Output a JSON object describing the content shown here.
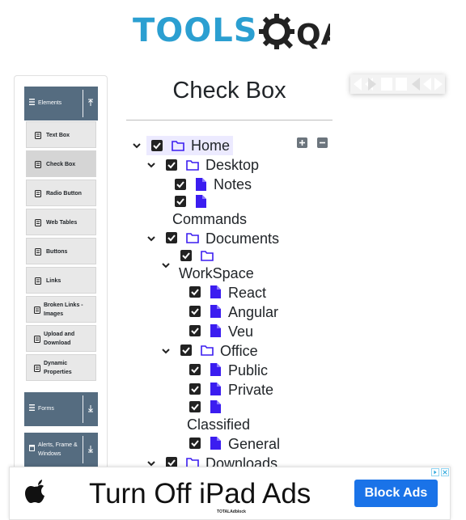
{
  "logo": {
    "word": "TOOLS",
    "suffix": "QA"
  },
  "sidebar": {
    "groups": [
      {
        "label": "Elements",
        "icon": "list-icon",
        "arrow": "collapse-arrow-icon"
      },
      {
        "label": "Forms",
        "icon": "list-icon",
        "arrow": "expand-arrow-icon"
      },
      {
        "label": "Alerts, Frame & Windows",
        "icon": "window-icon",
        "arrow": "expand-arrow-icon"
      }
    ],
    "items": [
      {
        "label": "Text Box"
      },
      {
        "label": "Check Box",
        "active": true
      },
      {
        "label": "Radio Button"
      },
      {
        "label": "Web Tables"
      },
      {
        "label": "Buttons"
      },
      {
        "label": "Links"
      },
      {
        "label": "Broken Links - Images"
      },
      {
        "label": "Upload and Download"
      },
      {
        "label": "Dynamic Properties"
      }
    ]
  },
  "main": {
    "title": "Check Box",
    "tree": {
      "home": "Home",
      "desktop": "Desktop",
      "notes": "Notes",
      "commands": "Commands",
      "documents": "Documents",
      "workspace": "WorkSpace",
      "react": "React",
      "angular": "Angular",
      "veu": "Veu",
      "office": "Office",
      "public": "Public",
      "private": "Private",
      "classified": "Classified",
      "general": "General",
      "downloads": "Downloads"
    },
    "expand_all_icon": "plus-square-icon",
    "collapse_all_icon": "minus-square-icon"
  },
  "ad": {
    "headline": "Turn Off iPad Ads",
    "button": "Block Ads",
    "brand": "TOTALAdblock",
    "accent": "#1a73e8"
  },
  "colors": {
    "sidebar_header": "#556c80",
    "logo_blue": "#2b9fd1",
    "home_highlight": "#eceaff",
    "file_icon": "#3b1df0"
  }
}
